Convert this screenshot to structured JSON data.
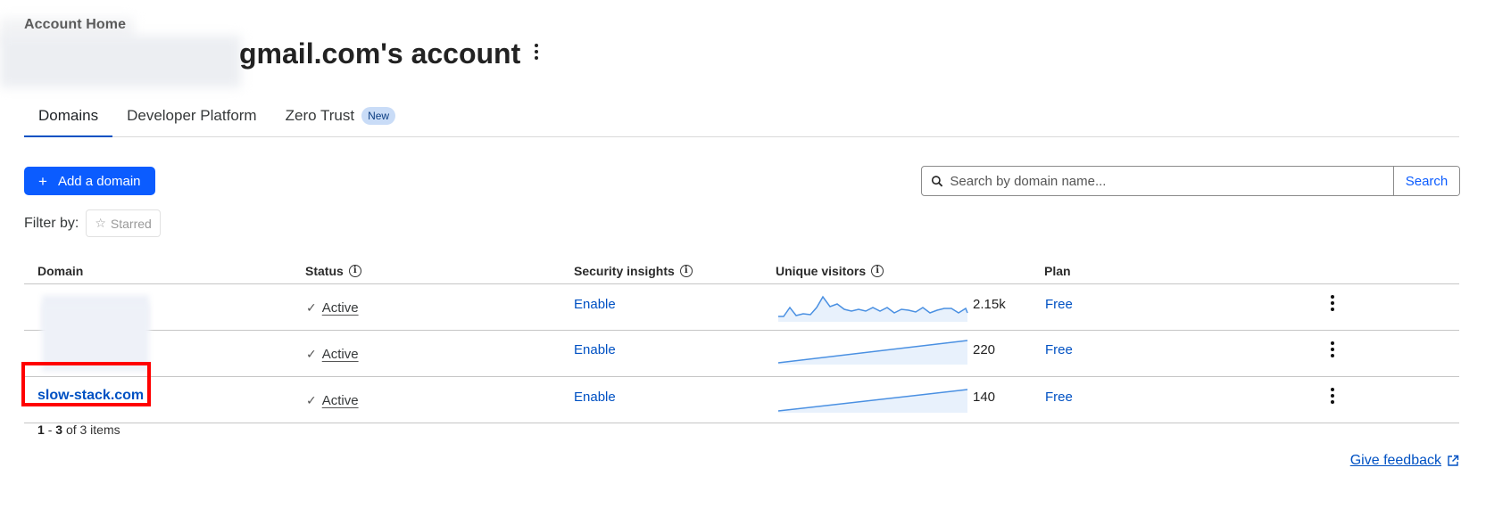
{
  "breadcrumb": "Account Home",
  "page_title": "gmail.com's account",
  "tabs": [
    {
      "label": "Domains"
    },
    {
      "label": "Developer Platform"
    },
    {
      "label": "Zero Trust",
      "badge": "New"
    }
  ],
  "toolbar": {
    "add_domain_label": "Add a domain",
    "search_placeholder": "Search by domain name...",
    "search_button": "Search"
  },
  "filter": {
    "label": "Filter by:",
    "starred": "Starred"
  },
  "table": {
    "headers": {
      "domain": "Domain",
      "status": "Status",
      "security": "Security insights",
      "visitors": "Unique visitors",
      "plan": "Plan"
    },
    "rows": [
      {
        "domain": "",
        "status": "Active",
        "security": "Enable",
        "visitors": "2.15k",
        "plan": "Free"
      },
      {
        "domain": "",
        "status": "Active",
        "security": "Enable",
        "visitors": "220",
        "plan": "Free"
      },
      {
        "domain": "slow-stack.com",
        "status": "Active",
        "security": "Enable",
        "visitors": "140",
        "plan": "Free"
      }
    ]
  },
  "pagination": {
    "start": "1",
    "sep": "-",
    "end": "3",
    "suffix": "of 3 items"
  },
  "feedback": "Give feedback",
  "colors": {
    "primary": "#0b5cff",
    "link": "#0051c3",
    "highlight": "#ff0000",
    "sparkline": "#4a90e2"
  }
}
